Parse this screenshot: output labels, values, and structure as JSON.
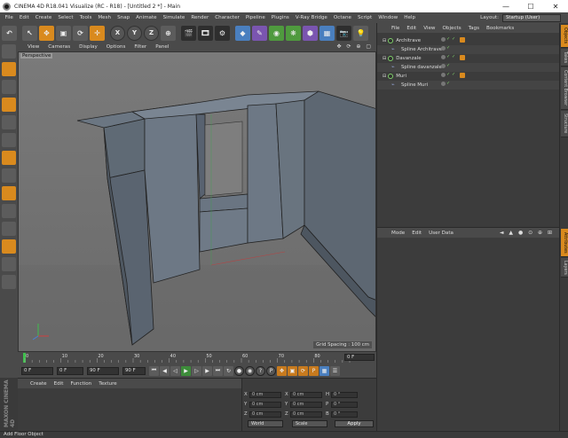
{
  "window": {
    "title": "CINEMA 4D R18.041 Visualize (RC - R18) - [Untitled 2 *] - Main",
    "minimize": "—",
    "maximize": "☐",
    "close": "✕"
  },
  "menubar": {
    "items": [
      "File",
      "Edit",
      "Create",
      "Select",
      "Tools",
      "Mesh",
      "Snap",
      "Animate",
      "Simulate",
      "Render",
      "Character",
      "Pipeline",
      "Plugins",
      "V-Ray Bridge",
      "Octane",
      "Script",
      "Window",
      "Help"
    ],
    "layout_label": "Layout:",
    "layout_value": "Startup (User)"
  },
  "toolbar": {
    "axis_x": "X",
    "axis_y": "Y",
    "axis_z": "Z"
  },
  "viewport": {
    "menu": [
      "View",
      "Cameras",
      "Display",
      "Options",
      "Filter",
      "Panel"
    ],
    "label": "Perspective",
    "grid_spacing": "Grid Spacing : 100 cm",
    "corner_icons": "✥ ⟳ ⊕ ▢"
  },
  "timeline": {
    "ticks": [
      "0",
      "10",
      "20",
      "30",
      "40",
      "50",
      "60",
      "70",
      "80",
      "90"
    ],
    "current_frame": "0 F"
  },
  "transport": {
    "start": "0 F",
    "current": "0 F",
    "end": "90 F",
    "end2": "90 F"
  },
  "material": {
    "menu": [
      "Create",
      "Edit",
      "Function",
      "Texture"
    ]
  },
  "maxon": {
    "logo_text": "MAXON CINEMA 4D"
  },
  "coords": {
    "rows": [
      {
        "a": "X",
        "av": "0 cm",
        "b": "X",
        "bv": "0 cm",
        "c": "H",
        "cv": "0 °"
      },
      {
        "a": "Y",
        "av": "0 cm",
        "b": "Y",
        "bv": "0 cm",
        "c": "P",
        "cv": "0 °"
      },
      {
        "a": "Z",
        "av": "0 cm",
        "b": "Z",
        "bv": "0 cm",
        "c": "B",
        "cv": "0 °"
      }
    ],
    "mode_world": "World",
    "mode_scale": "Scale",
    "apply": "Apply"
  },
  "objects": {
    "menu": [
      "File",
      "Edit",
      "View",
      "Objects",
      "Tags",
      "Bookmarks"
    ],
    "rows": [
      {
        "name": "Architrave",
        "type": "null",
        "indent": 0
      },
      {
        "name": "Spline Architrave",
        "type": "spline",
        "indent": 1
      },
      {
        "name": "Davanzale",
        "type": "null",
        "indent": 0
      },
      {
        "name": "Spline davanzale",
        "type": "spline",
        "indent": 1
      },
      {
        "name": "Muri",
        "type": "null",
        "indent": 0
      },
      {
        "name": "Spline Muri",
        "type": "spline",
        "indent": 1
      }
    ]
  },
  "attributes": {
    "menu": [
      "Mode",
      "Edit",
      "User Data"
    ],
    "icons": "◄ ▲ ● ⊙ ⊕ ⊞"
  },
  "right_tabs": {
    "top": [
      "Objects",
      "Takes",
      "Content Browser",
      "Structure"
    ],
    "bottom": [
      "Attributes",
      "Layers"
    ]
  },
  "status": {
    "text": "Add Floor Object"
  }
}
